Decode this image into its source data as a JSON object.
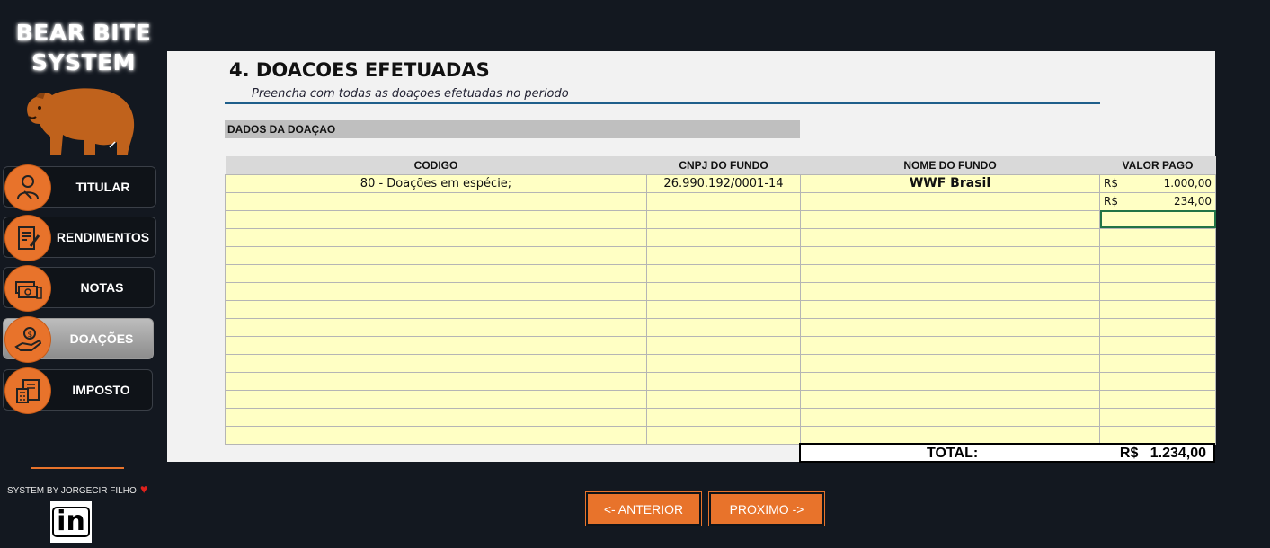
{
  "app": {
    "brand_line1": "BEAR BITE",
    "brand_line2": "SYSTEM"
  },
  "sidebar": {
    "items": [
      {
        "label": "TITULAR",
        "icon": "user-shield-icon",
        "active": false
      },
      {
        "label": "RENDIMENTOS",
        "icon": "document-pen-icon",
        "active": false
      },
      {
        "label": "NOTAS",
        "icon": "money-notes-icon",
        "active": false
      },
      {
        "label": "DOAÇÕES",
        "icon": "hand-coin-icon",
        "active": true
      },
      {
        "label": "IMPOSTO",
        "icon": "tax-calculator-icon",
        "active": false
      }
    ],
    "footer_text": "SYSTEM BY JORGECIR FILHO",
    "linkedin_label": "in"
  },
  "page": {
    "title": "4. DOACOES EFETUADAS",
    "subtitle": "Preencha com todas as doaçoes efetuadas no periodo",
    "section_label": "DADOS DA DOAÇAO"
  },
  "table": {
    "headers": {
      "codigo": "CODIGO",
      "cnpj": "CNPJ DO FUNDO",
      "nome": "NOME DO FUNDO",
      "valor": "VALOR PAGO"
    },
    "rows": [
      {
        "codigo": "80 - Doações em espécie;",
        "cnpj": "26.990.192/0001-14",
        "nome": "WWF Brasil",
        "currency": "R$",
        "valor": "1.000,00"
      },
      {
        "codigo": "",
        "cnpj": "",
        "nome": "",
        "currency": "R$",
        "valor": "234,00"
      },
      {
        "codigo": "",
        "cnpj": "",
        "nome": "",
        "currency": "",
        "valor": ""
      },
      {
        "codigo": "",
        "cnpj": "",
        "nome": "",
        "currency": "",
        "valor": ""
      },
      {
        "codigo": "",
        "cnpj": "",
        "nome": "",
        "currency": "",
        "valor": ""
      },
      {
        "codigo": "",
        "cnpj": "",
        "nome": "",
        "currency": "",
        "valor": ""
      },
      {
        "codigo": "",
        "cnpj": "",
        "nome": "",
        "currency": "",
        "valor": ""
      },
      {
        "codigo": "",
        "cnpj": "",
        "nome": "",
        "currency": "",
        "valor": ""
      },
      {
        "codigo": "",
        "cnpj": "",
        "nome": "",
        "currency": "",
        "valor": ""
      },
      {
        "codigo": "",
        "cnpj": "",
        "nome": "",
        "currency": "",
        "valor": ""
      },
      {
        "codigo": "",
        "cnpj": "",
        "nome": "",
        "currency": "",
        "valor": ""
      },
      {
        "codigo": "",
        "cnpj": "",
        "nome": "",
        "currency": "",
        "valor": ""
      },
      {
        "codigo": "",
        "cnpj": "",
        "nome": "",
        "currency": "",
        "valor": ""
      },
      {
        "codigo": "",
        "cnpj": "",
        "nome": "",
        "currency": "",
        "valor": ""
      },
      {
        "codigo": "",
        "cnpj": "",
        "nome": "",
        "currency": "",
        "valor": ""
      }
    ],
    "total_label": "TOTAL:",
    "total_currency": "R$",
    "total_value": "1.234,00"
  },
  "buttons": {
    "prev": "<- ANTERIOR",
    "next": "PROXIMO ->"
  },
  "colors": {
    "accent": "#e8732b",
    "cell_fill": "#ffffc4",
    "background": "#131820",
    "rule": "#1f5f8b"
  }
}
